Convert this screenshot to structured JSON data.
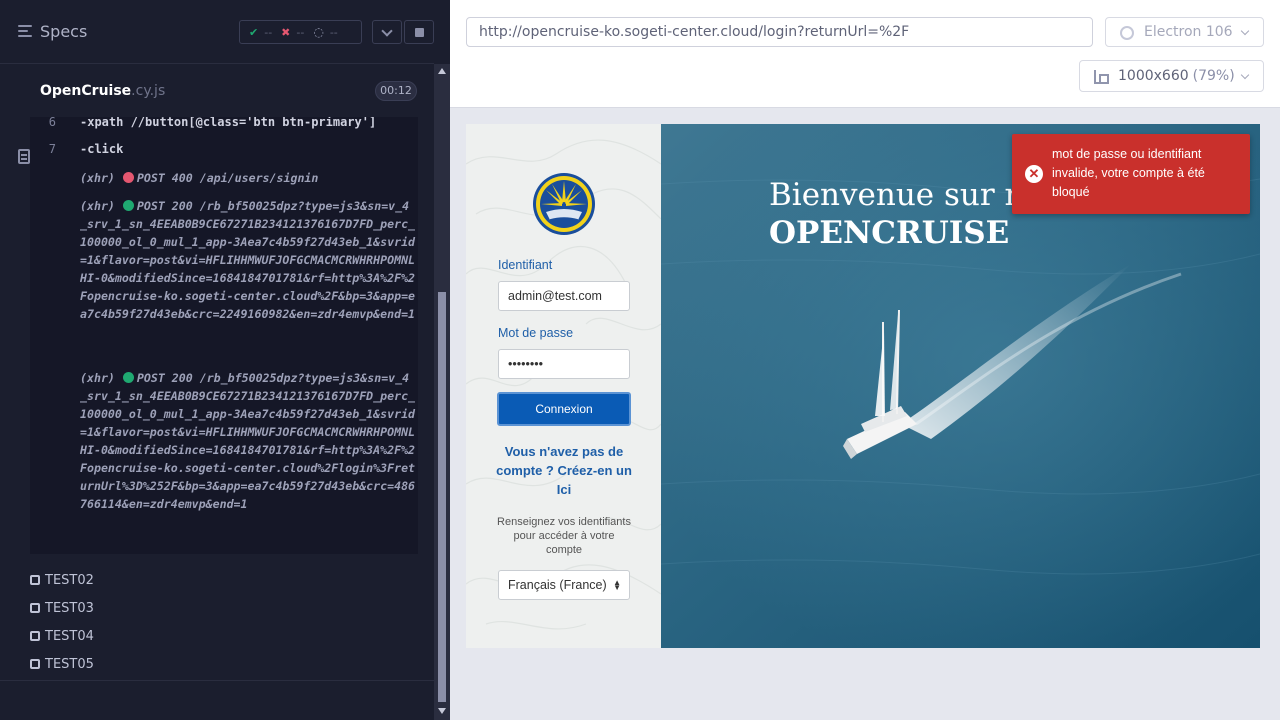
{
  "specs_header": {
    "title": "Specs",
    "passed": "--",
    "failed": "--",
    "pending": "--"
  },
  "spec_file": {
    "name": "OpenCruise",
    "ext": ".cy.js",
    "duration": "00:12"
  },
  "command_log": {
    "lines": [
      {
        "num": "6",
        "cmd": "-xpath  //button[@class='btn btn-primary']"
      },
      {
        "num": "7",
        "cmd": "-click"
      }
    ],
    "xhr": [
      {
        "tag": "(xhr)",
        "status": "error",
        "text": "POST 400 /api/users/signin"
      },
      {
        "tag": "(xhr)",
        "status": "ok",
        "text": "POST 200 /rb_bf50025dpz?type=js3&sn=v_4_srv_1_sn_4EEAB0B9CE67271B234121376167D7FD_perc_100000_ol_0_mul_1_app-3Aea7c4b59f27d43eb_1&svrid=1&flavor=post&vi=HFLIHHMWUFJOFGCMACMCRWHRHPOMNLHI-0&modifiedSince=1684184701781&rf=http%3A%2F%2Fopencruise-ko.sogeti-center.cloud%2F&bp=3&app=ea7c4b59f27d43eb&crc=2249160982&en=zdr4emvp&end=1"
      },
      {
        "tag": "(xhr)",
        "status": "ok",
        "text": "POST 200 /rb_bf50025dpz?type=js3&sn=v_4_srv_1_sn_4EEAB0B9CE67271B234121376167D7FD_perc_100000_ol_0_mul_1_app-3Aea7c4b59f27d43eb_1&svrid=1&flavor=post&vi=HFLIHHMWUFJOFGCMACMCRWHRHPOMNLHI-0&modifiedSince=1684184701781&rf=http%3A%2F%2Fopencruise-ko.sogeti-center.cloud%2Flogin%3FreturnUrl%3D%252F&bp=3&app=ea7c4b59f27d43eb&crc=486766114&en=zdr4emvp&end=1"
      }
    ]
  },
  "tests": [
    "TEST02",
    "TEST03",
    "TEST04",
    "TEST05"
  ],
  "browser_bar": {
    "url": "http://opencruise-ko.sogeti-center.cloud/login?returnUrl=%2F",
    "browser": "Electron 106",
    "viewport": "1000x660",
    "scale": "(79%)"
  },
  "app": {
    "login": {
      "username_label": "Identifiant",
      "username_value": "admin@test.com",
      "password_label": "Mot de passe",
      "password_value": "••••••••",
      "submit_label": "Connexion",
      "signup_link": "Vous n'avez pas de compte ? Créez-en un Ici",
      "help_text": "Renseignez vos identifiants pour accéder à votre compte",
      "language": "Français (France)"
    },
    "hero": {
      "welcome": "Bienvenue sur n",
      "brand": "OPENCRUISE"
    },
    "toast": {
      "message": "mot de passe ou identifiant invalide, votre compte à été bloqué"
    }
  },
  "colors": {
    "runner_bg": "#1b1e2e",
    "pass": "#1fa971",
    "fail": "#e45770",
    "primary_button": "#0a5bb5",
    "toast_bg": "#c9302c"
  }
}
